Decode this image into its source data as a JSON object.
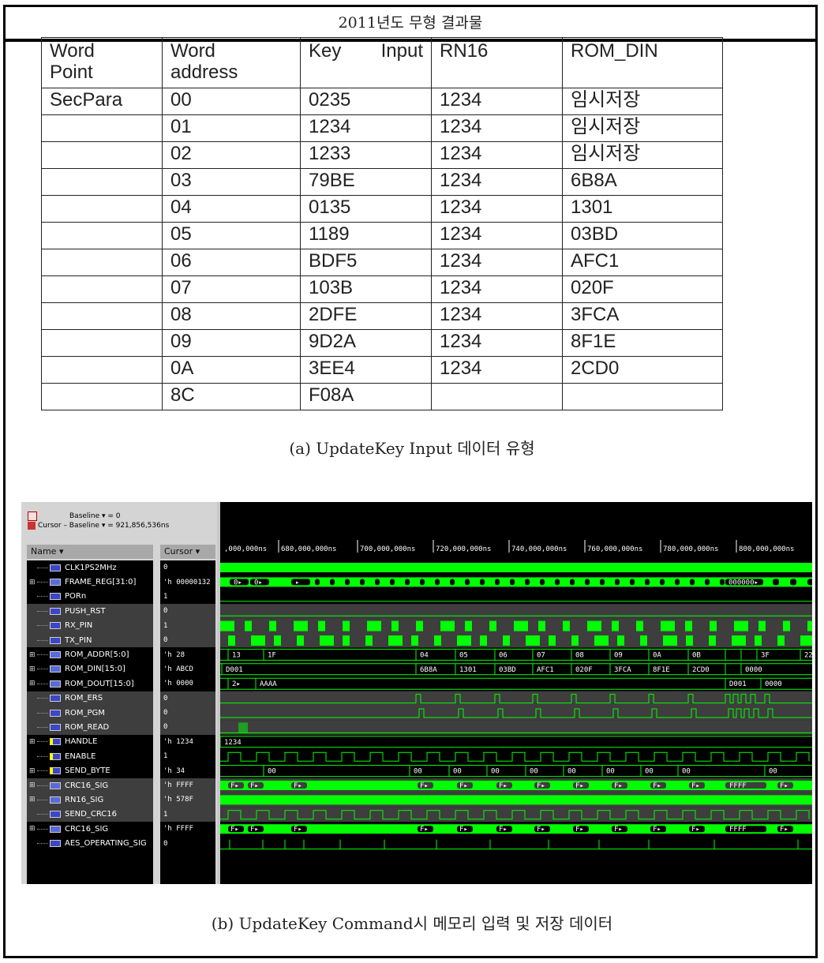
{
  "header": {
    "title": "2011년도 무형 결과물"
  },
  "table": {
    "columns": [
      "Word Point",
      "Word address",
      "Key Input",
      "RN16",
      "ROM_DIN"
    ],
    "column_lines": [
      [
        "Word",
        "Point"
      ],
      [
        "Word",
        "address"
      ],
      [
        "Key",
        "Input"
      ],
      [
        "RN16"
      ],
      [
        "ROM_DIN"
      ]
    ],
    "rows": [
      [
        "SecPara",
        "00",
        "0235",
        "1234",
        "임시저장"
      ],
      [
        "",
        "01",
        "1234",
        "1234",
        "임시저장"
      ],
      [
        "",
        "02",
        "1233",
        "1234",
        "임시저장"
      ],
      [
        "",
        "03",
        "79BE",
        "1234",
        "6B8A"
      ],
      [
        "",
        "04",
        "0135",
        "1234",
        "1301"
      ],
      [
        "",
        "05",
        "1189",
        "1234",
        "03BD"
      ],
      [
        "",
        "06",
        "BDF5",
        "1234",
        "AFC1"
      ],
      [
        "",
        "07",
        "103B",
        "1234",
        "020F"
      ],
      [
        "",
        "08",
        "2DFE",
        "1234",
        "3FCA"
      ],
      [
        "",
        "09",
        "9D2A",
        "1234",
        "8F1E"
      ],
      [
        "",
        "0A",
        "3EE4",
        "1234",
        "2CD0"
      ],
      [
        "",
        "8C",
        "F08A",
        "",
        ""
      ]
    ]
  },
  "caption_a": "(a) UpdateKey Input 데이터 유형",
  "caption_b": "(b) UpdateKey Command시 메모리 입력 및 저장 데이터",
  "viewer": {
    "baseline": "Baseline ▾ = 0",
    "cursor_baseline": "Cursor – Baseline ▾ = 921,856,536ns",
    "name_header": "Name ▾",
    "cursor_header": "Cursor ▾",
    "time_ticks": [
      ",000,000ns",
      "680,000,000ns",
      "700,000,000ns",
      "720,000,000ns",
      "740,000,000ns",
      "760,000,000ns",
      "780,000,000ns",
      "800,000,000ns"
    ],
    "colors": {
      "wave": "#00ff00",
      "background": "#000000",
      "group": "#3e3e3e"
    },
    "signals": [
      {
        "name": "CLK1PS2MHz",
        "value": "0",
        "kind": "bit",
        "expand": false,
        "group": false
      },
      {
        "name": "FRAME_REG[31:0]",
        "value": "'h 00000132",
        "kind": "bus",
        "expand": true,
        "group": false
      },
      {
        "name": "PORn",
        "value": "1",
        "kind": "bit",
        "expand": false,
        "group": false
      },
      {
        "name": "PUSH_RST",
        "value": "0",
        "kind": "bit",
        "expand": false,
        "group": true
      },
      {
        "name": "RX_PIN",
        "value": "1",
        "kind": "bit",
        "expand": false,
        "group": true
      },
      {
        "name": "TX_PIN",
        "value": "0",
        "kind": "bit",
        "expand": false,
        "group": true
      },
      {
        "name": "ROM_ADDR[5:0]",
        "value": "'h 28",
        "kind": "bus",
        "expand": true,
        "group": false
      },
      {
        "name": "ROM_DIN[15:0]",
        "value": "'h ABCD",
        "kind": "bus",
        "expand": true,
        "group": false
      },
      {
        "name": "ROM_DOUT[15:0]",
        "value": "'h 0000",
        "kind": "bus",
        "expand": true,
        "group": false
      },
      {
        "name": "ROM_ERS",
        "value": "0",
        "kind": "bit",
        "expand": false,
        "group": true
      },
      {
        "name": "ROM_PGM",
        "value": "0",
        "kind": "bit",
        "expand": false,
        "group": true
      },
      {
        "name": "ROM_READ",
        "value": "0",
        "kind": "bit",
        "expand": false,
        "group": true
      },
      {
        "name": "HANDLE",
        "value": "'h 1234",
        "kind": "in",
        "expand": true,
        "group": false
      },
      {
        "name": "ENABLE",
        "value": "1",
        "kind": "in",
        "expand": false,
        "group": false
      },
      {
        "name": "SEND_BYTE",
        "value": "'h 34",
        "kind": "in",
        "expand": true,
        "group": false
      },
      {
        "name": "CRC16_SIG",
        "value": "'h FFFF",
        "kind": "bus",
        "expand": true,
        "group": true
      },
      {
        "name": "RN16_SIG",
        "value": "'h 578F",
        "kind": "bus",
        "expand": true,
        "group": true
      },
      {
        "name": "SEND_CRC16",
        "value": "1",
        "kind": "out",
        "expand": false,
        "group": true
      },
      {
        "name": "CRC16_SIG",
        "value": "'h FFFF",
        "kind": "bus",
        "expand": true,
        "group": false
      },
      {
        "name": "AES_OPERATING_SIG",
        "value": "0",
        "kind": "bit",
        "expand": false,
        "group": false
      }
    ],
    "bus_labels": {
      "frame_reg": [
        "0▸",
        "0▸",
        "▸",
        "000000▸"
      ],
      "rom_addr": [
        "13",
        "1F",
        "04",
        "05",
        "06",
        "07",
        "08",
        "09",
        "0A",
        "0B",
        "3F",
        "22"
      ],
      "rom_din": [
        "D001",
        "6B8A",
        "1301",
        "03BD",
        "AFC1",
        "020F",
        "3FCA",
        "8F1E",
        "2CD0",
        "0000"
      ],
      "rom_dout": [
        "2▸",
        "AAAA",
        "D001",
        "0000"
      ],
      "handle": "1234",
      "send_byte": [
        "00",
        "00",
        "00",
        "00",
        "00",
        "00",
        "00",
        "00",
        "00",
        "00",
        "00"
      ],
      "crc16": [
        "F▸",
        "F▸",
        "F▸",
        "F▸",
        "F▸",
        "F▸",
        "F▸",
        "F▸",
        "F▸",
        "F▸",
        "F▸",
        "F▸",
        "FFFF",
        "F▸"
      ]
    }
  }
}
